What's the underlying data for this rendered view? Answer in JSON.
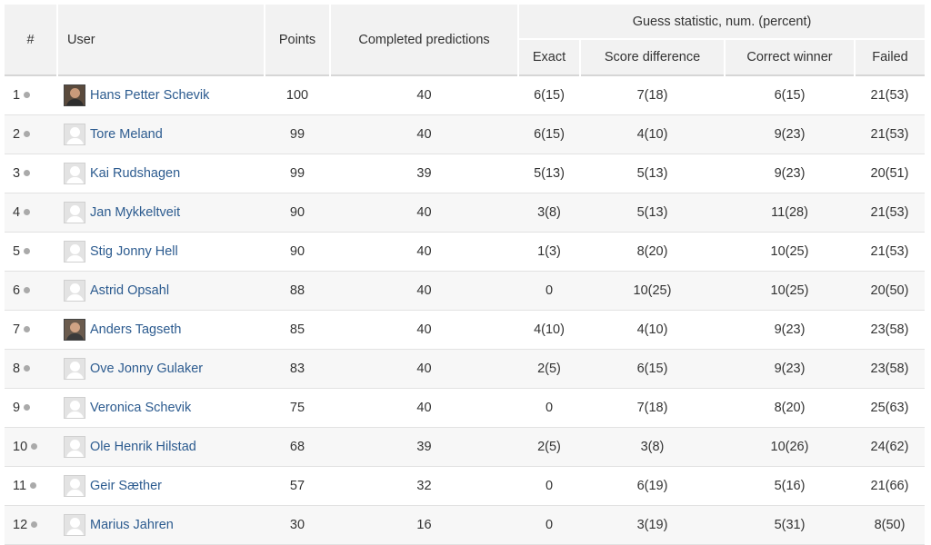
{
  "headers": {
    "rank": "#",
    "user": "User",
    "points": "Points",
    "completed": "Completed predictions",
    "guess_group": "Guess statistic, num. (percent)",
    "exact": "Exact",
    "score_diff": "Score difference",
    "correct_winner": "Correct winner",
    "failed": "Failed"
  },
  "rows": [
    {
      "rank": "1",
      "name": "Hans Petter Schevik",
      "avatar": "photo",
      "points": "100",
      "completed": "40",
      "exact": "6(15)",
      "score_diff": "7(18)",
      "correct_winner": "6(15)",
      "failed": "21(53)"
    },
    {
      "rank": "2",
      "name": "Tore Meland",
      "avatar": "default",
      "points": "99",
      "completed": "40",
      "exact": "6(15)",
      "score_diff": "4(10)",
      "correct_winner": "9(23)",
      "failed": "21(53)"
    },
    {
      "rank": "3",
      "name": "Kai Rudshagen",
      "avatar": "default",
      "points": "99",
      "completed": "39",
      "exact": "5(13)",
      "score_diff": "5(13)",
      "correct_winner": "9(23)",
      "failed": "20(51)"
    },
    {
      "rank": "4",
      "name": "Jan Mykkeltveit",
      "avatar": "default",
      "points": "90",
      "completed": "40",
      "exact": "3(8)",
      "score_diff": "5(13)",
      "correct_winner": "11(28)",
      "failed": "21(53)"
    },
    {
      "rank": "5",
      "name": "Stig Jonny Hell",
      "avatar": "default",
      "points": "90",
      "completed": "40",
      "exact": "1(3)",
      "score_diff": "8(20)",
      "correct_winner": "10(25)",
      "failed": "21(53)"
    },
    {
      "rank": "6",
      "name": "Astrid Opsahl",
      "avatar": "default",
      "points": "88",
      "completed": "40",
      "exact": "0",
      "score_diff": "10(25)",
      "correct_winner": "10(25)",
      "failed": "20(50)"
    },
    {
      "rank": "7",
      "name": "Anders Tagseth",
      "avatar": "photo2",
      "points": "85",
      "completed": "40",
      "exact": "4(10)",
      "score_diff": "4(10)",
      "correct_winner": "9(23)",
      "failed": "23(58)"
    },
    {
      "rank": "8",
      "name": "Ove Jonny Gulaker",
      "avatar": "default",
      "points": "83",
      "completed": "40",
      "exact": "2(5)",
      "score_diff": "6(15)",
      "correct_winner": "9(23)",
      "failed": "23(58)"
    },
    {
      "rank": "9",
      "name": "Veronica Schevik",
      "avatar": "default",
      "points": "75",
      "completed": "40",
      "exact": "0",
      "score_diff": "7(18)",
      "correct_winner": "8(20)",
      "failed": "25(63)"
    },
    {
      "rank": "10",
      "name": "Ole Henrik Hilstad",
      "avatar": "default",
      "points": "68",
      "completed": "39",
      "exact": "2(5)",
      "score_diff": "3(8)",
      "correct_winner": "10(26)",
      "failed": "24(62)"
    },
    {
      "rank": "11",
      "name": "Geir Sæther",
      "avatar": "default",
      "points": "57",
      "completed": "32",
      "exact": "0",
      "score_diff": "6(19)",
      "correct_winner": "5(16)",
      "failed": "21(66)"
    },
    {
      "rank": "12",
      "name": "Marius Jahren",
      "avatar": "default",
      "points": "30",
      "completed": "16",
      "exact": "0",
      "score_diff": "3(19)",
      "correct_winner": "5(31)",
      "failed": "8(50)"
    }
  ]
}
